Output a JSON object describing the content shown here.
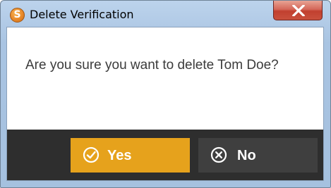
{
  "window": {
    "title": "Delete Verification",
    "app_icon_letter": "S",
    "close_icon": "close-x-icon"
  },
  "dialog": {
    "message": "Are you sure you want to delete Tom Doe?"
  },
  "buttons": {
    "yes": {
      "label": "Yes",
      "icon": "check-circle-icon",
      "color": "#e6a21c"
    },
    "no": {
      "label": "No",
      "icon": "x-circle-icon",
      "color": "#3f3f3f"
    }
  },
  "colors": {
    "titlebar": "#bcd3ec",
    "button_bar": "#2e2e2e",
    "close_button": "#c1402f",
    "message_text": "#3b3b3b"
  }
}
